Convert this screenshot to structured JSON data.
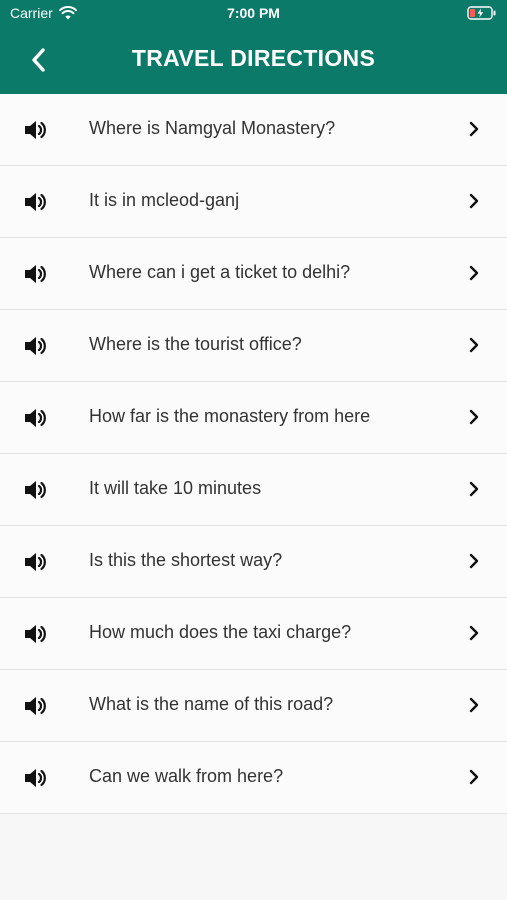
{
  "status_bar": {
    "carrier": "Carrier",
    "time": "7:00 PM",
    "wifi_icon": "wifi-icon",
    "battery_icon": "battery-charging-icon"
  },
  "header": {
    "title": "TRAVEL DIRECTIONS",
    "back_icon": "chevron-left-icon",
    "background_color": "#0b7a68"
  },
  "phrases": [
    {
      "text": "Where is Namgyal Monastery?"
    },
    {
      "text": "It is in mcleod-ganj"
    },
    {
      "text": "Where can i get a ticket to delhi?"
    },
    {
      "text": "Where is the tourist office?"
    },
    {
      "text": "How far is the monastery from here"
    },
    {
      "text": "It will take 10 minutes"
    },
    {
      "text": "Is this the shortest way?"
    },
    {
      "text": "How much does the taxi charge?"
    },
    {
      "text": "What is the name of this road?"
    },
    {
      "text": "Can we walk from here?"
    }
  ],
  "icons": {
    "speaker": "speaker-icon",
    "row_chevron": "chevron-right-icon"
  }
}
